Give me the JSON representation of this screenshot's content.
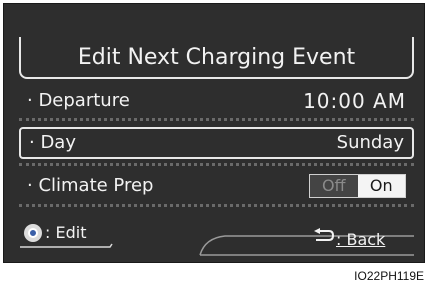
{
  "screen": {
    "title": "Edit Next Charging Event",
    "rows": [
      {
        "label": "· Departure",
        "value": "10:00 AM"
      },
      {
        "label": "· Day",
        "value": "Sunday"
      },
      {
        "label": "· Climate Prep"
      }
    ],
    "climate_toggle": {
      "off_label": "Off",
      "on_label": "On",
      "selected": "On"
    }
  },
  "footer": {
    "edit_label": ": Edit",
    "back_label": ": Back",
    "edit_icon": "controller-knob-icon",
    "back_icon": "back-arrow-icon"
  },
  "figure_code": "IO22PH119E",
  "colors": {
    "screen_bg": "#2e2e2e",
    "text": "#f2f2f2",
    "frame": "#e8e8e8",
    "toggle_on_bg": "#f4f4f4",
    "toggle_off_bg": "#444444"
  }
}
